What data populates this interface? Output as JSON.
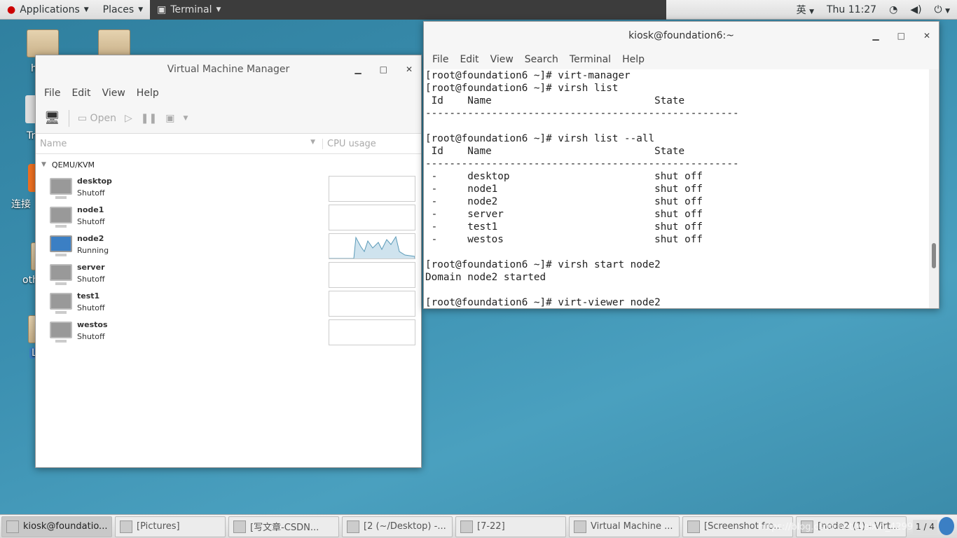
{
  "topbar": {
    "applications": "Applications",
    "places": "Places",
    "terminal": "Terminal",
    "input_method": "英",
    "clock": "Thu 11:27"
  },
  "desktop": {
    "icons": [
      {
        "label": "h"
      },
      {
        "label": ""
      },
      {
        "label": "Tr"
      },
      {
        "label": "连接"
      },
      {
        "label": "oth"
      },
      {
        "label": "L"
      }
    ]
  },
  "vmm": {
    "title": "Virtual Machine Manager",
    "menu": [
      "File",
      "Edit",
      "View",
      "Help"
    ],
    "toolbar": {
      "open": "Open"
    },
    "columns": {
      "name": "Name",
      "cpu": "CPU usage"
    },
    "group": "QEMU/KVM",
    "vms": [
      {
        "name": "desktop",
        "state": "Shutoff"
      },
      {
        "name": "node1",
        "state": "Shutoff"
      },
      {
        "name": "node2",
        "state": "Running"
      },
      {
        "name": "server",
        "state": "Shutoff"
      },
      {
        "name": "test1",
        "state": "Shutoff"
      },
      {
        "name": "westos",
        "state": "Shutoff"
      }
    ]
  },
  "terminal": {
    "title": "kiosk@foundation6:~",
    "menu": [
      "File",
      "Edit",
      "View",
      "Search",
      "Terminal",
      "Help"
    ],
    "lines": [
      "[root@foundation6 ~]# virt-manager",
      "[root@foundation6 ~]# virsh list",
      " Id    Name                           State",
      "----------------------------------------------------",
      "",
      "[root@foundation6 ~]# virsh list --all",
      " Id    Name                           State",
      "----------------------------------------------------",
      " -     desktop                        shut off",
      " -     node1                          shut off",
      " -     node2                          shut off",
      " -     server                         shut off",
      " -     test1                          shut off",
      " -     westos                         shut off",
      "",
      "[root@foundation6 ~]# virsh start node2",
      "Domain node2 started",
      "",
      "[root@foundation6 ~]# virt-viewer node2"
    ]
  },
  "taskbar": {
    "items": [
      "kiosk@foundatio...",
      "[Pictures]",
      "[写文章-CSDN...",
      "[2 (~/Desktop) -...",
      "[7-22]",
      "Virtual Machine ...",
      "[Screenshot fro...",
      "[node2 (1) - Virt..."
    ],
    "pager": "1 / 4",
    "watermark": "https://blog.csdn.net/weixin_4299363"
  }
}
